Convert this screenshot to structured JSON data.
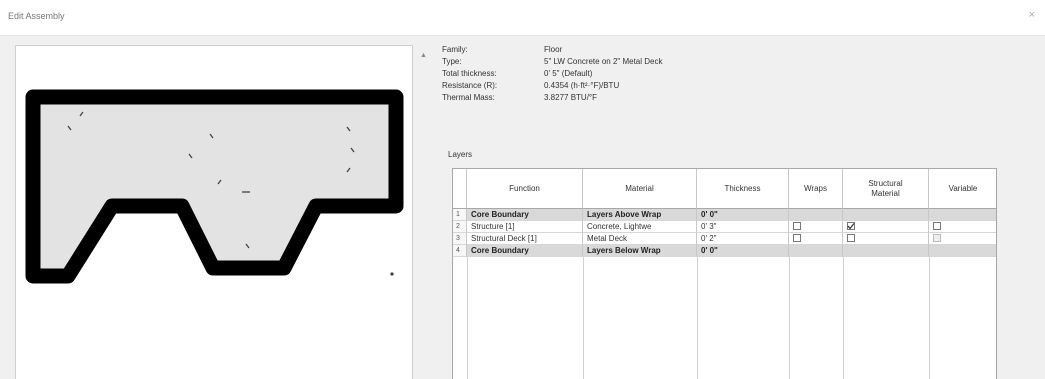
{
  "window": {
    "title": "Edit Assembly",
    "close_glyph": "×"
  },
  "properties": [
    {
      "label": "Family:",
      "value": "Floor"
    },
    {
      "label": "Type:",
      "value": "5\" LW Concrete on 2\" Metal Deck"
    },
    {
      "label": "Total thickness:",
      "value": "0' 5\" (Default)"
    },
    {
      "label": "Resistance (R):",
      "value": "0.4354 (h·ft²·°F)/BTU"
    },
    {
      "label": "Thermal Mass:",
      "value": "3.8277 BTU/°F"
    }
  ],
  "layers_label": "Layers",
  "columns": [
    "Function",
    "Material",
    "Thickness",
    "Wraps",
    "Structural Material",
    "Variable"
  ],
  "rows": [
    {
      "num": "1",
      "function": "Core Boundary",
      "material": "Layers Above Wrap",
      "thickness": "0' 0\"",
      "style": "gray",
      "wraps": null,
      "structural": null,
      "variable": null
    },
    {
      "num": "2",
      "function": "Structure [1]",
      "material": "Concrete, Lightwe",
      "thickness": "0' 3\"",
      "style": "white",
      "wraps": false,
      "structural": true,
      "variable": false
    },
    {
      "num": "3",
      "function": "Structural Deck [1]",
      "material": "Metal Deck",
      "thickness": "0' 2\"",
      "style": "white",
      "wraps": false,
      "structural": false,
      "variable": false
    },
    {
      "num": "4",
      "function": "Core Boundary",
      "material": "Layers Below Wrap",
      "thickness": "0' 0\"",
      "style": "gray",
      "wraps": null,
      "structural": null,
      "variable": null
    }
  ],
  "colors": {
    "profile_outline": "#000000",
    "profile_fill": "#e3e3e3",
    "core_row": "#d9d9d9"
  },
  "icons": {
    "scroll_up": "scroll-up-arrow-icon",
    "close": "close-icon",
    "section_marker": "section-cut-icon"
  }
}
